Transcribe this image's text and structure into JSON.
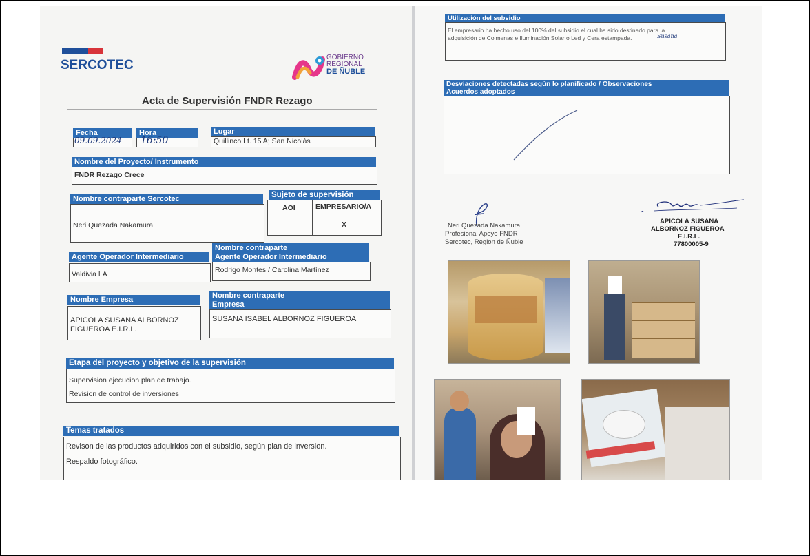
{
  "left": {
    "logo_text": "SERCOTEC",
    "gobierno": [
      "GOBIERNO",
      "REGIONAL",
      "DE ÑUBLE"
    ],
    "title": "Acta de Supervisión FNDR Rezago",
    "fecha_label": "Fecha",
    "fecha_value": "09.09.2024",
    "hora_label": "Hora",
    "hora_value": "16:50",
    "lugar_label": "Lugar",
    "lugar_value": "Quillinco Lt. 15 A; San Nicolás",
    "proyecto_label": "Nombre del Proyecto/ Instrumento",
    "proyecto_value": "FNDR Rezago Crece",
    "contraparte_sercotec_label": "Nombre contraparte Sercotec",
    "contraparte_sercotec_value": "Neri Quezada Nakamura",
    "sujeto_label": "Sujeto de supervisión",
    "sujeto_col1": "AOI",
    "sujeto_col2": "EMPRESARIO/A",
    "sujeto_mark": "X",
    "agente_label": "Agente Operador  Intermediario",
    "agente_value": "Valdivia LA",
    "contraparte_agente_label1": "Nombre contraparte",
    "contraparte_agente_label2": "Agente Operador Intermediario",
    "contraparte_agente_value": "Rodrigo Montes / Carolina Martínez",
    "empresa_label": "Nombre Empresa",
    "empresa_value1": "APICOLA SUSANA ALBORNOZ",
    "empresa_value2": "FIGUEROA E.I.R.L.",
    "contraparte_empresa_label1": "Nombre contraparte",
    "contraparte_empresa_label2": "Empresa",
    "contraparte_empresa_value": "SUSANA ISABEL ALBORNOZ FIGUEROA",
    "etapa_label": "Etapa del proyecto y objetivo de la supervisión",
    "etapa_line1": "Supervision ejecucion plan de trabajo.",
    "etapa_line2": "Revision de control de inversiones",
    "temas_label": "Temas  tratados",
    "temas_line1": "Revison de las productos adquiridos con el subsidio, según plan de inversion.",
    "temas_line2": "Respaldo fotográfico."
  },
  "right": {
    "utilizacion_label": "Utilización del subsidio",
    "utilizacion_line1": "El empresario ha hecho uso del 100% del subsidio el cual ha sido destinado para la",
    "utilizacion_line2": "adquisición de Colmenas e Iluminación Solar o Led y Cera estampada.",
    "utilizacion_initials": "Susana",
    "desviaciones_label1": "Desviaciones detectadas según lo planificado / Observaciones",
    "desviaciones_label2": "Acuerdos adoptados",
    "firma1_line1": "Neri Quezada Nakamura",
    "firma1_line2": "Profesional Apoyo FNDR",
    "firma1_line3": "Sercotec, Region de Ñuble",
    "firma2_line1": "APICOLA SUSANA",
    "firma2_line2": "ALBORNOZ FIGUEROA",
    "firma2_line3": "E.I.R.L.",
    "firma2_line4": "77800005-9"
  },
  "colors": {
    "header_blue": "#2d6db5",
    "sercotec_blue": "#1f4f9a",
    "sercotec_red": "#d8343a"
  }
}
